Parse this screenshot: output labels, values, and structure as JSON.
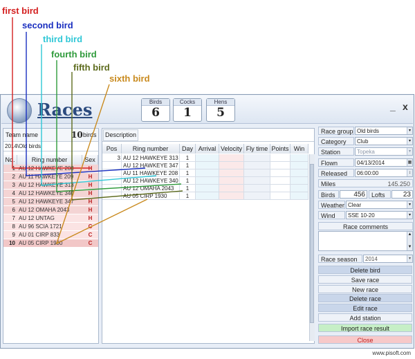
{
  "annotations": [
    {
      "label": "first bird",
      "color": "#d42020"
    },
    {
      "label": "second bird",
      "color": "#1a2fc0"
    },
    {
      "label": "third bird",
      "color": "#2fc7d6"
    },
    {
      "label": "fourth bird",
      "color": "#2e9a3a"
    },
    {
      "label": "fifth bird",
      "color": "#5d6b1d"
    },
    {
      "label": "sixth bird",
      "color": "#c98a1e"
    }
  ],
  "app": {
    "title": "Races"
  },
  "counters": [
    {
      "label": "Birds",
      "value": "6"
    },
    {
      "label": "Cocks",
      "value": "1"
    },
    {
      "label": "Hens",
      "value": "5"
    }
  ],
  "window_buttons": {
    "minimize": "_",
    "close": "x"
  },
  "team": {
    "name_label": "Team name",
    "count_value": "10",
    "count_unit": "birds",
    "subtitle": "2014\\Old birds",
    "columns": [
      "No.",
      "Ring number",
      "Sex"
    ],
    "rows": [
      {
        "no": "1",
        "ring": "AU 12 HAWKEYE 208",
        "sex": "H"
      },
      {
        "no": "2",
        "ring": "AU 11 HAWKEYE 209",
        "sex": "H"
      },
      {
        "no": "3",
        "ring": "AU 12 HAWKEYE 313",
        "sex": "H"
      },
      {
        "no": "4",
        "ring": "AU 12 HAWKEYE 340",
        "sex": "H"
      },
      {
        "no": "5",
        "ring": "AU 12 HAWKEYE 347",
        "sex": "H"
      },
      {
        "no": "6",
        "ring": "AU 12 OMAHA 2043",
        "sex": "H"
      },
      {
        "no": "7",
        "ring": "AU 12 UNTAG",
        "sex": "H"
      },
      {
        "no": "8",
        "ring": "AU 96 SCIA 1721",
        "sex": "C"
      },
      {
        "no": "9",
        "ring": "AU 01 CIRP 833",
        "sex": "C"
      },
      {
        "no": "10",
        "ring": "AU 05 CIRP 1930",
        "sex": "C"
      }
    ]
  },
  "race_list": {
    "description_label": "Description",
    "columns": [
      "Pos",
      "Ring number",
      "Day",
      "Arrival",
      "Velocity",
      "Fly time",
      "Points",
      "Win"
    ],
    "rows": [
      {
        "pos": "3",
        "ring": "AU 12 HAWKEYE 313",
        "day": "1"
      },
      {
        "pos": "",
        "ring": "AU 12 HAWKEYE 347",
        "day": "1"
      },
      {
        "pos": "",
        "ring": "AU 11 HAWKEYE 208",
        "day": "1"
      },
      {
        "pos": "",
        "ring": "AU 12 HAWKEYE 340",
        "day": "1"
      },
      {
        "pos": "",
        "ring": "AU 12 OMAHA 2043",
        "day": "1"
      },
      {
        "pos": "",
        "ring": "AU 05 CIRP 1930",
        "day": "1"
      }
    ]
  },
  "race_props": {
    "race_group": {
      "label": "Race group",
      "value": "Old birds"
    },
    "category": {
      "label": "Category",
      "value": "Club"
    },
    "station": {
      "label": "Station",
      "value": "Topeka"
    },
    "flown": {
      "label": "Flown",
      "value": "04/13/2014"
    },
    "released": {
      "label": "Released",
      "value": "06:00:00"
    },
    "miles": {
      "label": "Miles",
      "value": "145.250"
    },
    "birds": {
      "label": "Birds",
      "value": "456"
    },
    "lofts": {
      "label": "Lofts",
      "value": "23"
    },
    "weather": {
      "label": "Weather",
      "value": "Clear"
    },
    "wind": {
      "label": "Wind",
      "value": "SSE 10-20"
    },
    "comments_label": "Race comments",
    "season": {
      "label": "Race season",
      "value": "2014"
    }
  },
  "actions": [
    {
      "label": "Delete bird",
      "bg": "#c9d6ea"
    },
    {
      "label": "Save race",
      "bg": "#eef2f8"
    },
    {
      "label": "New race",
      "bg": "#eef2f8"
    },
    {
      "label": "Delete race",
      "bg": "#c9d6ea"
    },
    {
      "label": "Edit race",
      "bg": "#c9d6ea"
    },
    {
      "label": "Add station",
      "bg": "#eef2f8"
    },
    {
      "label": "Import race result",
      "bg": "#c6efc6"
    },
    {
      "label": "Close",
      "bg": "#f7c9c9"
    }
  ],
  "footer": {
    "url": "www.pisoft.com"
  }
}
